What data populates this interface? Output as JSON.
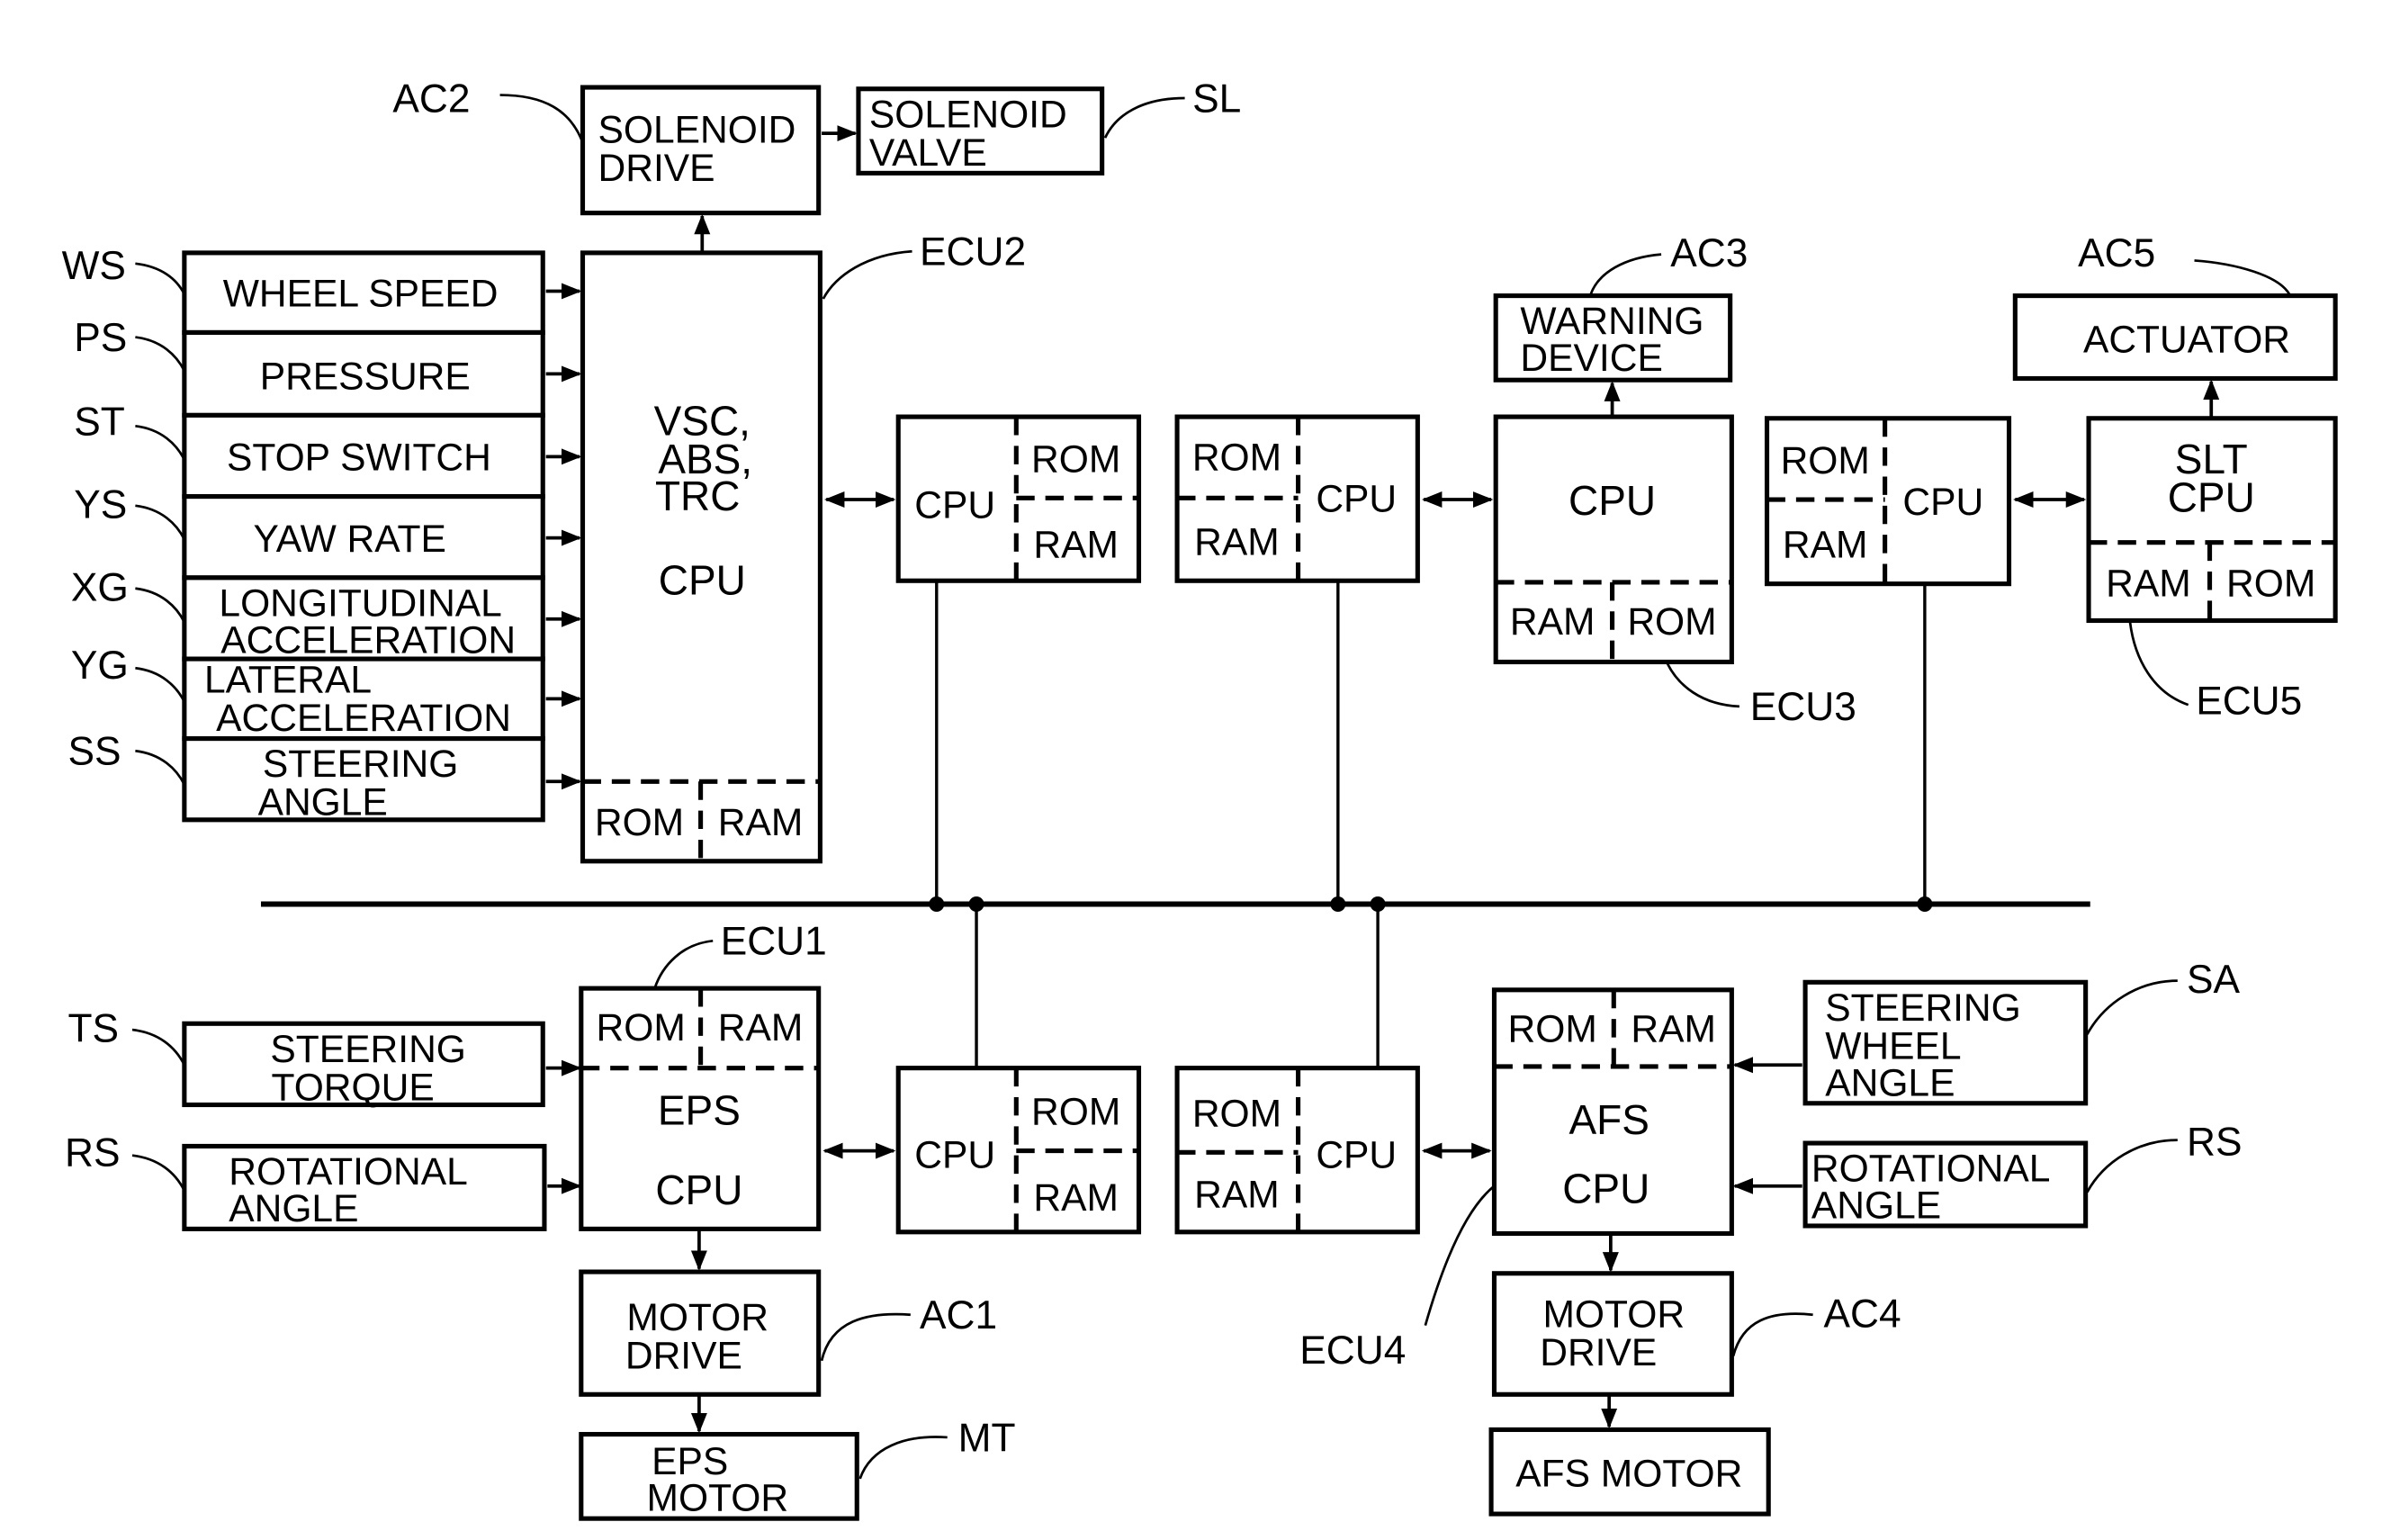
{
  "figure": {
    "reference_labels": {
      "ac2": "AC2",
      "sl": "SL",
      "ecu2": "ECU2",
      "ac3": "AC3",
      "ac5": "AC5",
      "ecu3": "ECU3",
      "ecu5": "ECU5",
      "ecu1": "ECU1",
      "ac1": "AC1",
      "mt": "MT",
      "ecu4": "ECU4",
      "ac4": "AC4",
      "sa": "SA",
      "rs_right": "RS",
      "ws": "WS",
      "ps": "PS",
      "st": "ST",
      "ys": "YS",
      "xg": "XG",
      "yg": "YG",
      "ss": "SS",
      "ts": "TS",
      "rs_left": "RS"
    },
    "sensors_ecu2": [
      {
        "line1": "WHEEL SPEED",
        "line2": ""
      },
      {
        "line1": "PRESSURE",
        "line2": ""
      },
      {
        "line1": "STOP SWITCH",
        "line2": ""
      },
      {
        "line1": "YAW RATE",
        "line2": ""
      },
      {
        "line1": "LONGITUDINAL",
        "line2": "ACCELERATION"
      },
      {
        "line1": "LATERAL",
        "line2": "ACCELERATION"
      },
      {
        "line1": "STEERING",
        "line2": "ANGLE"
      }
    ],
    "solenoid_drive": {
      "line1": "SOLENOID",
      "line2": "DRIVE"
    },
    "solenoid_valve": {
      "line1": "SOLENOID",
      "line2": "VALVE"
    },
    "ecu2_cpu": {
      "line1": "VSC,",
      "line2": "ABS,",
      "line3": "TRC",
      "line4": "CPU",
      "rom": "ROM",
      "ram": "RAM"
    },
    "comm_cpu": {
      "cpu": "CPU",
      "rom": "ROM",
      "ram": "RAM"
    },
    "warning_device": {
      "line1": "WARNING",
      "line2": "DEVICE"
    },
    "ecu3_cpu": {
      "cpu": "CPU",
      "ram": "RAM",
      "rom": "ROM"
    },
    "actuator": {
      "label": "ACTUATOR"
    },
    "ecu5_cpu": {
      "line1": "SLT",
      "line2": "CPU",
      "ram": "RAM",
      "rom": "ROM"
    },
    "steering_torque": {
      "line1": "STEERING",
      "line2": "TORQUE"
    },
    "rotational_angle_left": {
      "line1": "ROTATIONAL",
      "line2": "ANGLE"
    },
    "ecu1_cpu": {
      "rom": "ROM",
      "ram": "RAM",
      "line1": "EPS",
      "line2": "CPU"
    },
    "motor_drive_1": {
      "line1": "MOTOR",
      "line2": "DRIVE"
    },
    "eps_motor": {
      "line1": "EPS",
      "line2": "MOTOR"
    },
    "ecu4_cpu": {
      "rom": "ROM",
      "ram": "RAM",
      "line1": "AFS",
      "line2": "CPU"
    },
    "steering_wheel_angle": {
      "line1": "STEERING",
      "line2": "WHEEL",
      "line3": "ANGLE"
    },
    "rotational_angle_right": {
      "line1": "ROTATIONAL",
      "line2": "ANGLE"
    },
    "motor_drive_4": {
      "line1": "MOTOR",
      "line2": "DRIVE"
    },
    "afs_motor": {
      "label": "AFS MOTOR"
    }
  }
}
